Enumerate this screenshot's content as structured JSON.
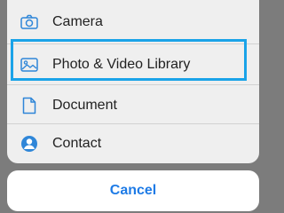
{
  "action_sheet": {
    "items": [
      {
        "label": "Camera",
        "icon": "camera-icon"
      },
      {
        "label": "Photo & Video Library",
        "icon": "photo-icon"
      },
      {
        "label": "Document",
        "icon": "document-icon"
      },
      {
        "label": "Contact",
        "icon": "contact-icon"
      }
    ],
    "highlighted_item": "Photo & Video Library",
    "cancel_label": "Cancel"
  },
  "colors": {
    "accent": "#1e7be6",
    "icon": "#2f86d8",
    "highlight_border": "#1aa3e8",
    "sheet_background": "#efefef",
    "backdrop": "#7c7c7c"
  }
}
